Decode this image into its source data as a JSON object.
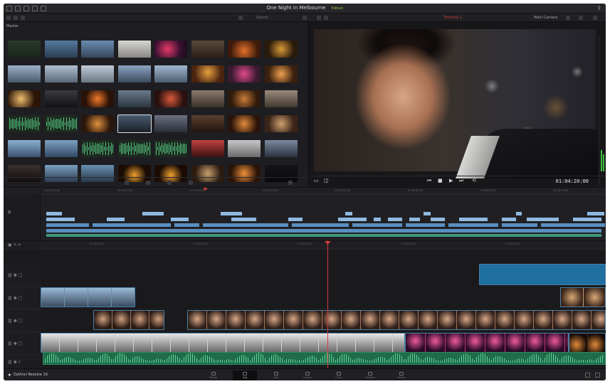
{
  "window": {
    "project_title": "One Night in Melbourne",
    "project_status": "Edited"
  },
  "toolbar": {
    "pool_label": "Master",
    "search_label": "Search",
    "viewer_clip_name": "Timeline 1",
    "viewer_right_label": "Main Camera"
  },
  "viewer": {
    "timecode": "01:04:20:00"
  },
  "timeline": {
    "upper_ticks": [
      "01:00:00:00",
      "01:01:20:00",
      "01:02:40:00",
      "01:04:00:00",
      "01:05:20:00",
      "01:06:40:00",
      "01:08:00:00",
      "01:09:20:00"
    ],
    "lower_ticks": [
      "01:03:40:00",
      "01:04:00:00",
      "01:04:20:00",
      "01:04:40:00",
      "01:05:00:00"
    ]
  },
  "statusbar": {
    "app_name": "DaVinci Resolve 16",
    "pages": [
      "Media",
      "Cut",
      "Edit",
      "Fusion",
      "Color",
      "Fairlight",
      "Deliver"
    ],
    "active_page": "Cut"
  },
  "colors": {
    "accent_green": "#8fc43a",
    "playhead_red": "#d23b3b",
    "clip_blue": "#5a8fc0",
    "audio_green": "#1f6b4a"
  }
}
